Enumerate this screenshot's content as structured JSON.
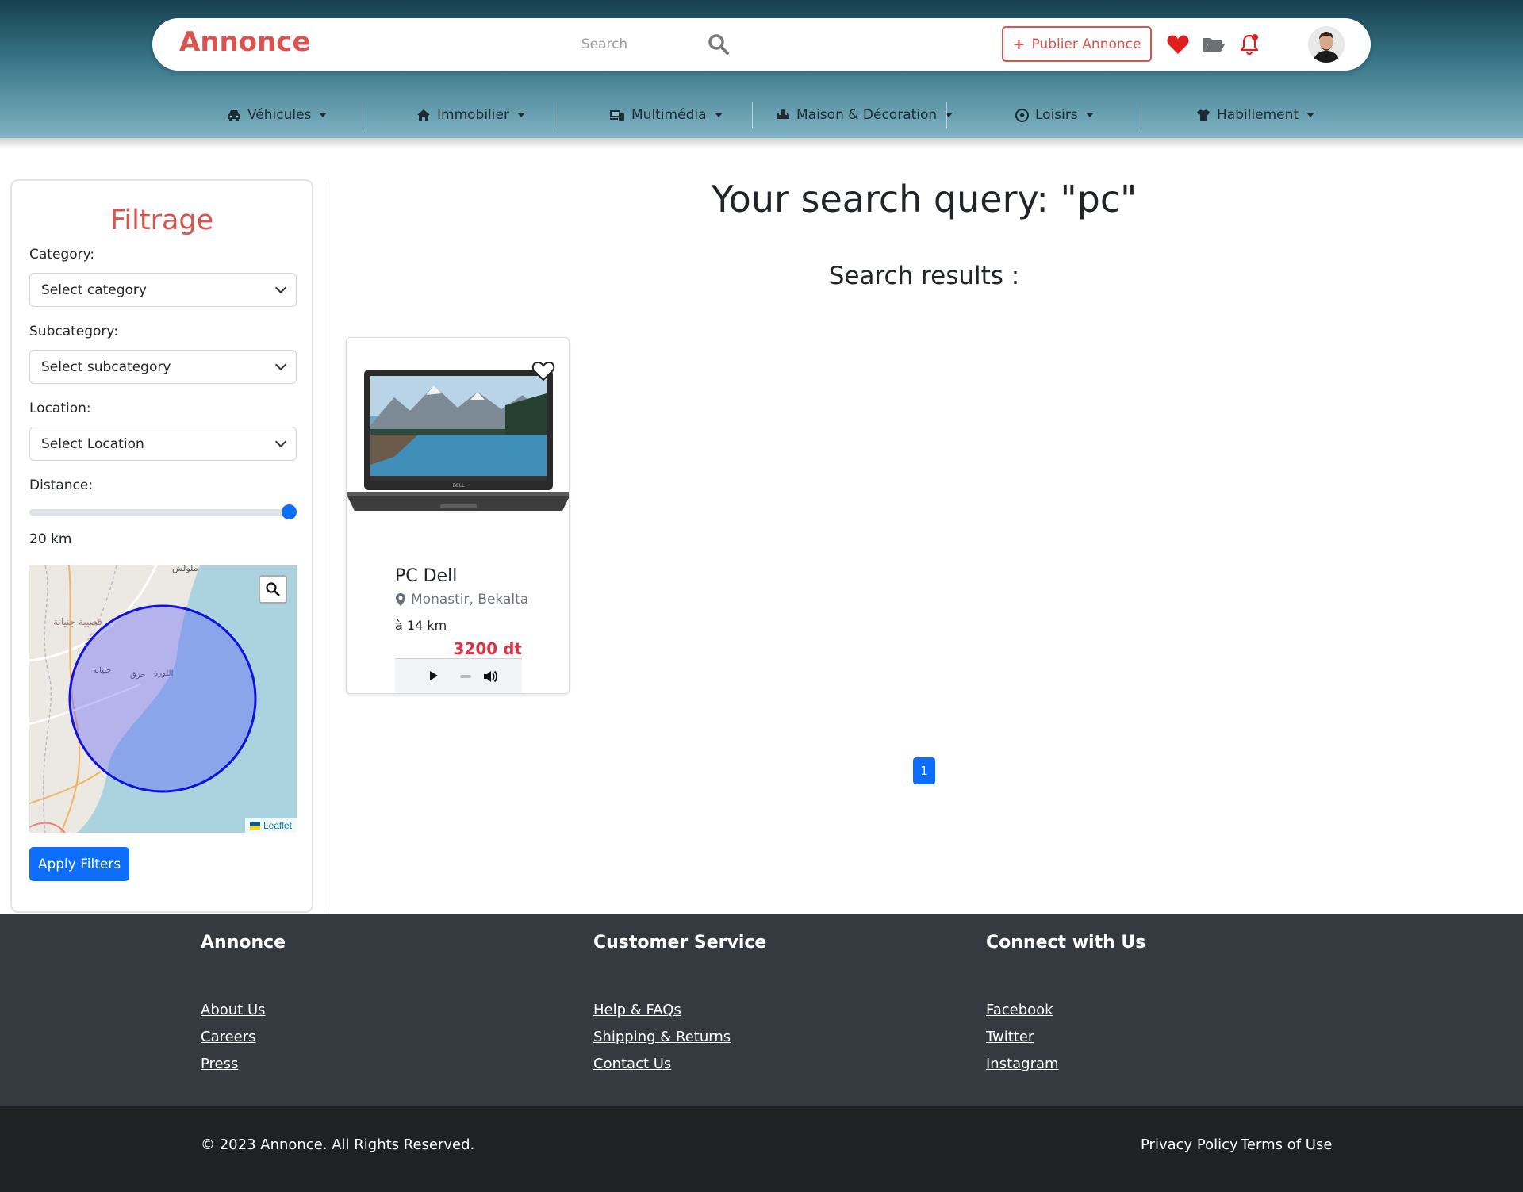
{
  "header": {
    "brand": "Annonce",
    "search_placeholder": "Search",
    "publish_label": "Publier Annonce",
    "colors": {
      "brand": "#d9534f",
      "heart": "#e01e1e",
      "notification_dot": "#e01e1e"
    }
  },
  "categories": [
    {
      "label": "Véhicules",
      "icon": "car-icon"
    },
    {
      "label": "Immobilier",
      "icon": "house-icon"
    },
    {
      "label": "Multimédia",
      "icon": "devices-icon"
    },
    {
      "label": "Maison & Décoration",
      "icon": "couch-icon"
    },
    {
      "label": "Loisirs",
      "icon": "soccer-ball-icon"
    },
    {
      "label": "Habillement",
      "icon": "shirt-icon"
    }
  ],
  "sidebar": {
    "title": "Filtrage",
    "category_label": "Category:",
    "category_value": "Select category",
    "subcategory_label": "Subcategory:",
    "subcategory_value": "Select subcategory",
    "location_label": "Location:",
    "location_value": "Select Location",
    "distance_label": "Distance:",
    "distance_slider_fraction": 1.0,
    "distance_value": "20 km",
    "map": {
      "labels": [
        "ملولش",
        "قصيبة جنيانة",
        "جنيانة",
        "حزق",
        "اللورة"
      ],
      "attribution": "Leaflet"
    },
    "apply_label": "Apply Filters"
  },
  "main": {
    "query_title": "Your search query: \"pc\"",
    "results_title": "Search results :",
    "listing": {
      "title": "PC Dell",
      "location": "Monastir, Bekalta",
      "distance": "à 14 km",
      "price": "3200 dt"
    },
    "pagination": {
      "current": "1"
    }
  },
  "footer": {
    "columns": [
      {
        "title": "Annonce",
        "links": [
          "About Us",
          "Careers",
          "Press"
        ]
      },
      {
        "title": "Customer Service",
        "links": [
          "Help & FAQs",
          "Shipping & Returns",
          "Contact Us"
        ]
      },
      {
        "title": "Connect with Us",
        "links": [
          "Facebook",
          "Twitter",
          "Instagram"
        ]
      }
    ],
    "copyright": "© 2023 Annonce. All Rights Reserved.",
    "privacy": "Privacy Policy",
    "terms": "Terms of Use"
  }
}
